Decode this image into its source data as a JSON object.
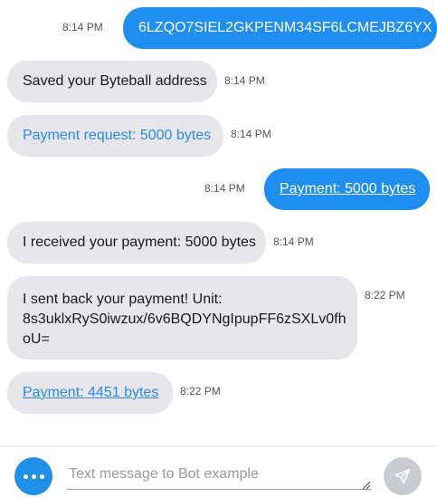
{
  "messages": [
    {
      "from": "user",
      "time": "8:14 PM",
      "text": "6LZQO7SIEL2GKPENM34SF6LCMEJBZ6YX"
    },
    {
      "from": "bot",
      "time": "8:14 PM",
      "text": "Saved your Byteball address"
    },
    {
      "from": "bot",
      "time": "8:14 PM",
      "text": "Payment request: 5000 bytes"
    },
    {
      "from": "user",
      "time": "8:14 PM",
      "text": "Payment: 5000 bytes"
    },
    {
      "from": "bot",
      "time": "8:14 PM",
      "text": "I received your payment: 5000 bytes"
    },
    {
      "from": "bot",
      "time": "8:22 PM",
      "lines": [
        "I sent back your payment! Unit:",
        "8s3uklxRyS0iwzux/6v6BQDYNgIpupFF6zSXLv0fh",
        "oU="
      ]
    },
    {
      "from": "bot",
      "time": "8:22 PM",
      "text": "Payment: 4451 bytes"
    }
  ],
  "composer": {
    "placeholder": "Text message to Bot example",
    "more_icon": "more-horizontal-icon",
    "send_icon": "send-icon"
  },
  "colors": {
    "outgoing_bubble": "#1e8ef0",
    "incoming_bubble": "#e6e6eb",
    "link": "#2a8ae6",
    "send_disabled": "#c8ccd2"
  }
}
